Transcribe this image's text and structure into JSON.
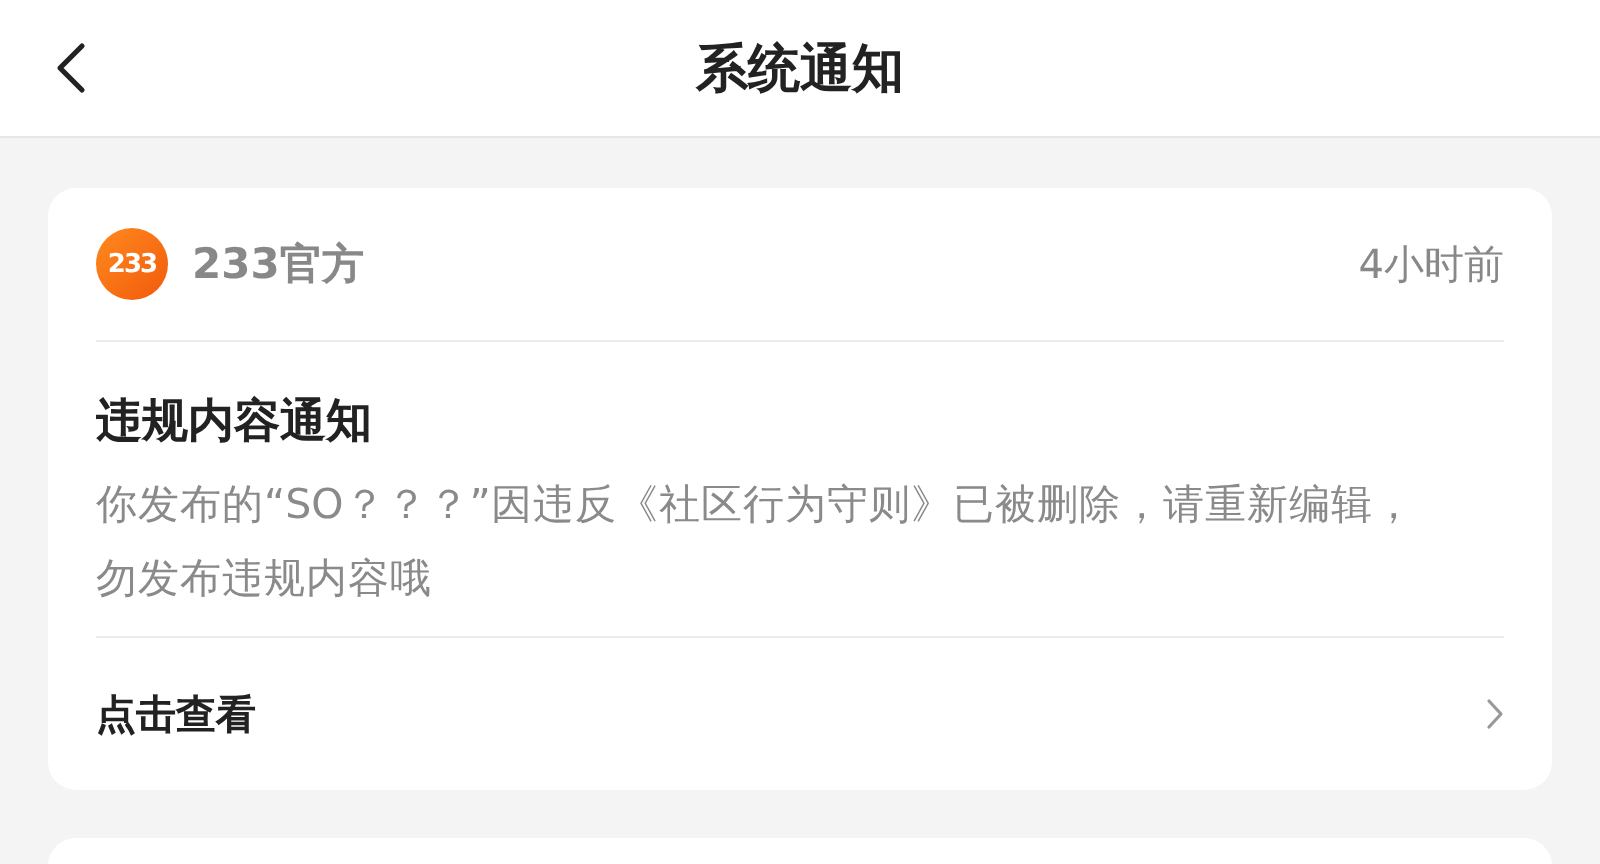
{
  "header": {
    "title": "系统通知"
  },
  "notifications": [
    {
      "logo": "233",
      "source": "233官方",
      "time": "4小时前",
      "title": "违规内容通知",
      "body": "你发布的“SO？？？”因违反《社区行为守则》已被删除，请重新编辑，勿发布违规内容哦",
      "action": "点击查看"
    }
  ]
}
